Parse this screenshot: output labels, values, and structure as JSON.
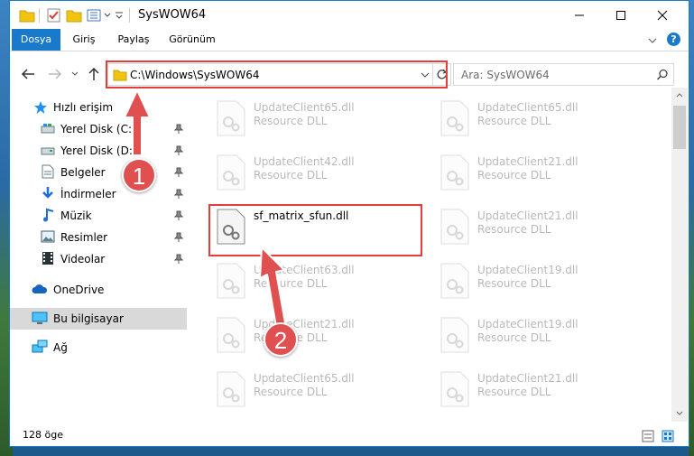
{
  "window": {
    "title": "SysWOW64"
  },
  "ribbon": {
    "tabs": [
      "Dosya",
      "Giriş",
      "Paylaş",
      "Görünüm"
    ],
    "active_tab": "Dosya"
  },
  "address": {
    "path": "C:\\Windows\\SysWOW64"
  },
  "search": {
    "placeholder": "Ara: SysWOW64"
  },
  "nav_pane": {
    "quick_access": "Hızlı erişim",
    "items": [
      "Yerel Disk (C:)",
      "Yerel Disk (D:)",
      "Belgeler",
      "İndirmeler",
      "Müzik",
      "Resimler",
      "Videolar"
    ],
    "onedrive": "OneDrive",
    "this_pc": "Bu bilgisayar",
    "network": "Ağ"
  },
  "files": [
    {
      "name": "UpdateClient65.dll",
      "type": "Resource DLL"
    },
    {
      "name": "UpdateClient65.dll",
      "type": "Resource DLL"
    },
    {
      "name": "UpdateClient42.dll",
      "type": "Resource DLL"
    },
    {
      "name": "UpdateClient21.dll",
      "type": "Resource DLL"
    },
    {
      "name": "sf_matrix_sfun.dll",
      "type": ""
    },
    {
      "name": "UpdateClient21.dll",
      "type": "Resource DLL"
    },
    {
      "name": "UpdateClient63.dll",
      "type": "Resource DLL"
    },
    {
      "name": "UpdateClient19.dll",
      "type": "Resource DLL"
    },
    {
      "name": "UpdateClient21.dll",
      "type": "Resource DLL"
    },
    {
      "name": "UpdateClient19.dll",
      "type": "Resource DLL"
    },
    {
      "name": "UpdateClient65.dll",
      "type": "Resource DLL"
    },
    {
      "name": "UpdateClient21.dll",
      "type": "Resource DLL"
    }
  ],
  "status": {
    "count": "128 öge"
  },
  "annotations": {
    "step1": "1",
    "step2": "2"
  },
  "colors": {
    "accent": "#1979ca",
    "highlight": "#e53c3c",
    "badge": "#e05050",
    "selected": "#d9d9d9"
  },
  "icons": [
    "folder-icon",
    "checklist-icon",
    "properties-icon",
    "back-arrow-icon",
    "forward-arrow-icon",
    "up-arrow-icon",
    "refresh-icon",
    "search-icon",
    "pin-icon",
    "dll-file-icon"
  ]
}
